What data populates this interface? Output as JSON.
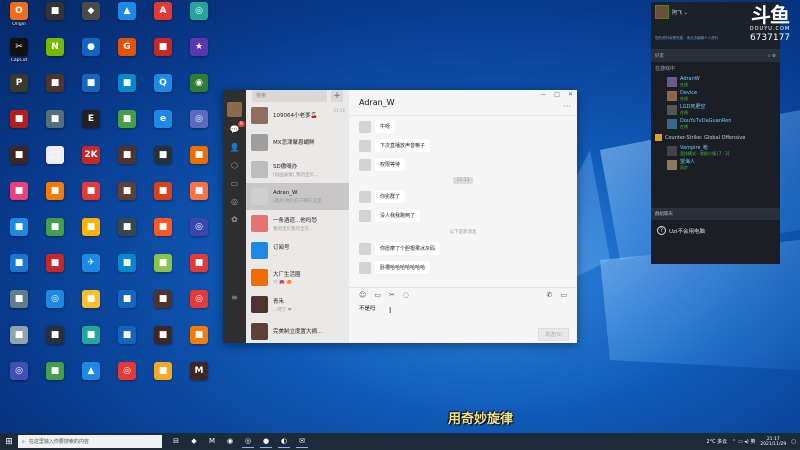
{
  "desktop": {
    "icons": [
      {
        "label": "Origin",
        "glyph": "O",
        "color": "#f06b1a"
      },
      {
        "label": "",
        "glyph": "■",
        "color": "#333333"
      },
      {
        "label": "",
        "glyph": "◆",
        "color": "#4a4a4a"
      },
      {
        "label": "",
        "glyph": "▲",
        "color": "#1e88e5"
      },
      {
        "label": "",
        "glyph": "A",
        "color": "#e53935"
      },
      {
        "label": "",
        "glyph": "◎",
        "color": "#26a69a"
      },
      {
        "label": "CapCut",
        "glyph": "✂",
        "color": "#111111"
      },
      {
        "label": "",
        "glyph": "N",
        "color": "#76b900"
      },
      {
        "label": "",
        "glyph": "●",
        "color": "#1565c0"
      },
      {
        "label": "",
        "glyph": "G",
        "color": "#e65100"
      },
      {
        "label": "",
        "glyph": "■",
        "color": "#c62828"
      },
      {
        "label": "",
        "glyph": "★",
        "color": "#5e35b1"
      },
      {
        "label": "",
        "glyph": "P",
        "color": "#3a3a2a"
      },
      {
        "label": "",
        "glyph": "■",
        "color": "#4e342e"
      },
      {
        "label": "",
        "glyph": "■",
        "color": "#1565c0"
      },
      {
        "label": "",
        "glyph": "■",
        "color": "#0288d1"
      },
      {
        "label": "",
        "glyph": "Q",
        "color": "#1e88e5"
      },
      {
        "label": "",
        "glyph": "◉",
        "color": "#2e7d32"
      },
      {
        "label": "",
        "glyph": "■",
        "color": "#b71c1c"
      },
      {
        "label": "",
        "glyph": "■",
        "color": "#546e7a"
      },
      {
        "label": "",
        "glyph": "E",
        "color": "#222222"
      },
      {
        "label": "",
        "glyph": "■",
        "color": "#43a047"
      },
      {
        "label": "",
        "glyph": "e",
        "color": "#1e88e5"
      },
      {
        "label": "",
        "glyph": "◎",
        "color": "#5c6bc0"
      },
      {
        "label": "",
        "glyph": "■",
        "color": "#3e2723"
      },
      {
        "label": "",
        "glyph": "□",
        "color": "#eeeeee"
      },
      {
        "label": "",
        "glyph": "2K",
        "color": "#c62828"
      },
      {
        "label": "",
        "glyph": "■",
        "color": "#4e342e"
      },
      {
        "label": "",
        "glyph": "■",
        "color": "#263238"
      },
      {
        "label": "",
        "glyph": "■",
        "color": "#ef6c00"
      },
      {
        "label": "",
        "glyph": "■",
        "color": "#ec407a"
      },
      {
        "label": "",
        "glyph": "■",
        "color": "#f57c00"
      },
      {
        "label": "",
        "glyph": "■",
        "color": "#e53935"
      },
      {
        "label": "",
        "glyph": "■",
        "color": "#5d4037"
      },
      {
        "label": "",
        "glyph": "■",
        "color": "#d84315"
      },
      {
        "label": "",
        "glyph": "■",
        "color": "#ff7043"
      },
      {
        "label": "",
        "glyph": "■",
        "color": "#1e88e5"
      },
      {
        "label": "",
        "glyph": "■",
        "color": "#43a047"
      },
      {
        "label": "",
        "glyph": "■",
        "color": "#ffb300"
      },
      {
        "label": "",
        "glyph": "■",
        "color": "#37474f"
      },
      {
        "label": "",
        "glyph": "■",
        "color": "#ff5722"
      },
      {
        "label": "",
        "glyph": "◎",
        "color": "#3949ab"
      },
      {
        "label": "",
        "glyph": "■",
        "color": "#1976d2"
      },
      {
        "label": "",
        "glyph": "■",
        "color": "#c62828"
      },
      {
        "label": "",
        "glyph": "✈",
        "color": "#1e88e5"
      },
      {
        "label": "",
        "glyph": "■",
        "color": "#0288d1"
      },
      {
        "label": "",
        "glyph": "■",
        "color": "#8bc34a"
      },
      {
        "label": "",
        "glyph": "■",
        "color": "#e53935"
      },
      {
        "label": "",
        "glyph": "■",
        "color": "#607d8b"
      },
      {
        "label": "",
        "glyph": "◎",
        "color": "#1e88e5"
      },
      {
        "label": "",
        "glyph": "■",
        "color": "#fbc02d"
      },
      {
        "label": "",
        "glyph": "■",
        "color": "#1565c0"
      },
      {
        "label": "",
        "glyph": "■",
        "color": "#4e342e"
      },
      {
        "label": "",
        "glyph": "◎",
        "color": "#e53935"
      },
      {
        "label": "",
        "glyph": "■",
        "color": "#90a4ae"
      },
      {
        "label": "",
        "glyph": "■",
        "color": "#263238"
      },
      {
        "label": "",
        "glyph": "■",
        "color": "#26a69a"
      },
      {
        "label": "",
        "glyph": "■",
        "color": "#1565c0"
      },
      {
        "label": "",
        "glyph": "■",
        "color": "#3e2723"
      },
      {
        "label": "",
        "glyph": "■",
        "color": "#f57c00"
      },
      {
        "label": "",
        "glyph": "◎",
        "color": "#3f51b5"
      },
      {
        "label": "",
        "glyph": "■",
        "color": "#43a047"
      },
      {
        "label": "",
        "glyph": "▲",
        "color": "#1e88e5"
      },
      {
        "label": "",
        "glyph": "◎",
        "color": "#e53935"
      },
      {
        "label": "",
        "glyph": "■",
        "color": "#f9a825"
      },
      {
        "label": "",
        "glyph": "M",
        "color": "#3e2723"
      }
    ]
  },
  "wechat": {
    "search_placeholder": "搜索",
    "plus": "+",
    "badge": "9",
    "conversations": [
      {
        "name": "109064小老爹🍒",
        "preview": "",
        "time": "21:16",
        "color": "#8d6e63",
        "active": false
      },
      {
        "name": "MX怎津聚恩蝴鲜",
        "preview": "",
        "time": "",
        "color": "#9e9e9e",
        "active": false
      },
      {
        "name": "SD傲嘅办",
        "preview": "[动画表情] 我的宝贝...",
        "time": "",
        "color": "#bdbdbd",
        "active": false
      },
      {
        "name": "Adran_W",
        "preview": "[图片]你们在干嘛在这里",
        "time": "",
        "color": "#cfcfcf",
        "active": true
      },
      {
        "name": "一条酒道...他吗😈",
        "preview": "我的宝贝我的宝贝...",
        "time": "",
        "color": "#e57373",
        "active": false
      },
      {
        "name": "订阅号",
        "preview": "...",
        "time": "",
        "color": "#1e88e5",
        "active": false
      },
      {
        "name": "大厂生活圈",
        "preview": "😊 🌺 🍊",
        "time": "",
        "color": "#ef6c00",
        "active": false
      },
      {
        "name": "青禾",
        "preview": "...呵了 ❤",
        "time": "",
        "color": "#4e342e",
        "active": false
      },
      {
        "name": "完美制立度置大祸...",
        "preview": "",
        "time": "",
        "color": "#5d4037",
        "active": false
      }
    ],
    "chat_title": "Adran_W",
    "more": "···",
    "win_min": "—",
    "win_max": "□",
    "win_close": "✕",
    "messages": [
      {
        "type": "in",
        "text": "牛呀"
      },
      {
        "type": "in",
        "text": "下次直播放声音嘛子"
      },
      {
        "type": "in",
        "text": "权限等待"
      },
      {
        "type": "sys",
        "text": "21:13"
      },
      {
        "type": "in",
        "text": "你劣群了"
      },
      {
        "type": "in",
        "text": "没人我我跑两了"
      },
      {
        "type": "sys-plain",
        "text": "以下是新消息"
      },
      {
        "type": "in",
        "text": "你愿摩了个胆根果冰灰码"
      },
      {
        "type": "in",
        "text": "卧槽哈哈哈哈哈哈哈"
      }
    ],
    "input_text": "不是吗",
    "cursor": "I",
    "send_label": "发送(S)"
  },
  "steam": {
    "username": "阿飞 ⌄",
    "link_text": "您的资料尚需完善，请点击编辑个人资料",
    "tab_label": "好友",
    "in_game_header": "在游戏中",
    "friends_top": [
      {
        "name": "AdranW",
        "status": "在线",
        "color": "#6a5a8a"
      },
      {
        "name": "Device",
        "status": "在线",
        "color": "#8a6a4a"
      },
      {
        "name": "LGD死肥空",
        "status": "在线",
        "color": "#555555"
      },
      {
        "name": "DouYuTvDaGuanRen",
        "status": "在线",
        "color": "#3a6a8a"
      }
    ],
    "game_name": "Counter-Strike: Global Offensive",
    "friends_game": [
      {
        "name": "Vampire_枪",
        "status": "竞技模式 - 地狱小镇 [7 : 2]",
        "color": "#444444"
      },
      {
        "name": "望海人",
        "status": "同步",
        "color": "#8a7a5a"
      }
    ],
    "chat_header": "群组聊天",
    "chat_item": "Uzi不会用电脑"
  },
  "douyu": {
    "logo": "斗鱼",
    "sub": "DOUYU.COM",
    "count": "6737177"
  },
  "subtitle": "用奇妙旋律",
  "taskbar": {
    "start": "⊞",
    "search_placeholder": "在这里输入你要搜索的内容",
    "apps": [
      "⊟",
      "◆",
      "M",
      "◉",
      "◎",
      "●",
      "◐",
      "✉"
    ],
    "weather": "2°C 多云",
    "time": "21:17",
    "date": "2021/11/29"
  }
}
